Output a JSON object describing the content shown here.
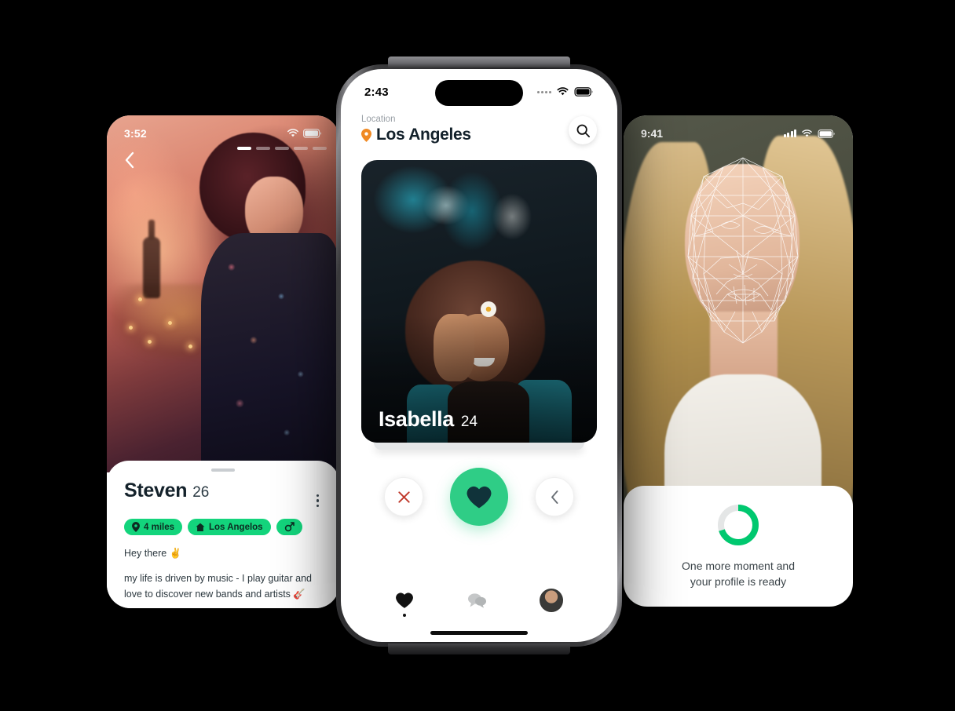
{
  "app": {
    "accent_green": "#2fcd86",
    "pill_green": "#13d47c",
    "heart_dark": "#10333a",
    "progress_green": "#00c86f",
    "reject_red": "#c0392b"
  },
  "left_phone": {
    "status": {
      "time": "3:52",
      "wifi_icon": "wifi-icon",
      "battery_icon": "battery-icon"
    },
    "back_icon": "chevron-left-icon",
    "photo_segments": {
      "total": 5,
      "active_index": 0
    },
    "profile": {
      "name": "Steven",
      "age": "26",
      "menu_icon": "kebab-menu-icon",
      "pills": [
        {
          "icon": "location-pin-icon",
          "label": "4 miles"
        },
        {
          "icon": "home-icon",
          "label": "Los Angelos"
        },
        {
          "icon": "male-gender-icon",
          "label": ""
        }
      ],
      "bio_line_1": "Hey there ✌️",
      "bio_line_2": "my life is driven by music - I play guitar and love to discover new bands and artists 🎸"
    }
  },
  "center_phone": {
    "status": {
      "time": "2:43",
      "cellular_icon": "cellular-dots-icon",
      "wifi_icon": "wifi-icon",
      "battery_icon": "battery-icon"
    },
    "header": {
      "location_label": "Location",
      "location_value": "Los Angeles",
      "location_icon": "location-pin-icon",
      "search_icon": "search-icon"
    },
    "card": {
      "name": "Isabella",
      "age": "24"
    },
    "actions": {
      "reject_icon": "close-x-icon",
      "like_icon": "heart-icon",
      "rewind_icon": "chevron-left-icon"
    },
    "tabbar": [
      {
        "icon": "heart-icon",
        "name": "tab-discover",
        "active": true
      },
      {
        "icon": "chat-bubbles-icon",
        "name": "tab-messages",
        "active": false
      },
      {
        "icon": "avatar-icon",
        "name": "tab-profile",
        "active": false
      }
    ]
  },
  "right_phone": {
    "status": {
      "time": "9:41",
      "cellular_icon": "signal-bars-icon",
      "wifi_icon": "wifi-icon",
      "battery_icon": "battery-icon"
    },
    "face_scan": {
      "overlay_icon": "face-mesh-icon"
    },
    "loading": {
      "progress_percent": 70,
      "spinner_icon": "progress-ring-icon",
      "message_line_1": "One more moment and",
      "message_line_2": "your profile is ready"
    }
  }
}
